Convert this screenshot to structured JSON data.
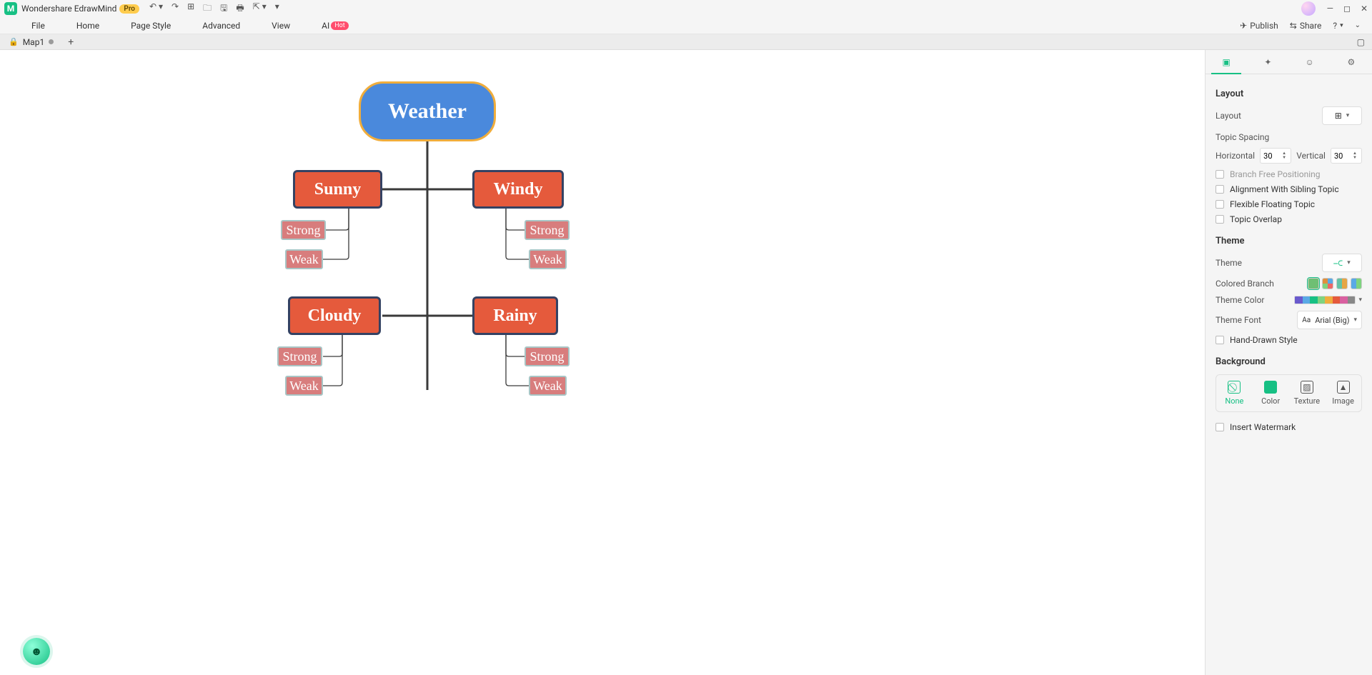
{
  "app": {
    "name": "Wondershare EdrawMind",
    "badge": "Pro"
  },
  "menu": {
    "items": [
      "File",
      "Home",
      "Page Style",
      "Advanced",
      "View"
    ],
    "ai_label": "AI",
    "ai_badge": "Hot",
    "publish": "Publish",
    "share": "Share"
  },
  "tabs": {
    "name": "Map1"
  },
  "mindmap": {
    "root": "Weather",
    "branches": [
      {
        "label": "Sunny",
        "children": [
          "Strong",
          "Weak"
        ]
      },
      {
        "label": "Windy",
        "children": [
          "Strong",
          "Weak"
        ]
      },
      {
        "label": "Cloudy",
        "children": [
          "Strong",
          "Weak"
        ]
      },
      {
        "label": "Rainy",
        "children": [
          "Strong",
          "Weak"
        ]
      }
    ]
  },
  "panel": {
    "layout": {
      "heading": "Layout",
      "layout_label": "Layout",
      "spacing_label": "Topic Spacing",
      "horizontal_label": "Horizontal",
      "horizontal_value": "30",
      "vertical_label": "Vertical",
      "vertical_value": "30",
      "branch_free": "Branch Free Positioning",
      "align_sibling": "Alignment With Sibling Topic",
      "flex_float": "Flexible Floating Topic",
      "overlap": "Topic Overlap"
    },
    "theme": {
      "heading": "Theme",
      "theme_label": "Theme",
      "colored_branch": "Colored Branch",
      "theme_color": "Theme Color",
      "theme_font": "Theme Font",
      "theme_font_value": "Arial (Big)",
      "hand_drawn": "Hand-Drawn Style"
    },
    "background": {
      "heading": "Background",
      "none": "None",
      "color": "Color",
      "texture": "Texture",
      "image": "Image",
      "watermark": "Insert Watermark"
    }
  }
}
